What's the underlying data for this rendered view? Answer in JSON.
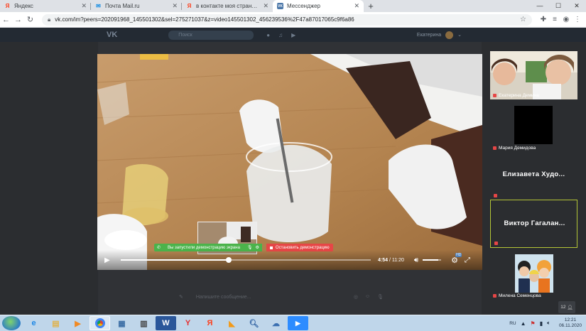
{
  "browser": {
    "tabs": [
      {
        "title": "Яндекс",
        "favicon": "Я",
        "favicon_color": "#fc3f1d",
        "active": false
      },
      {
        "title": "Почта Mail.ru",
        "favicon": "✉",
        "favicon_color": "#168de2",
        "active": false
      },
      {
        "title": "в контакте моя страница вход ...",
        "favicon": "Я",
        "favicon_color": "#fc3f1d",
        "active": false
      },
      {
        "title": "Мессенджер",
        "favicon": "VK",
        "favicon_color": "#4a76a8",
        "active": true
      }
    ],
    "new_tab_label": "+",
    "url": "vk.com/im?peers=202091968_145501302&sel=275271037&z=video145501302_456239536%2F47a87017065c9f6a86"
  },
  "vk": {
    "search_placeholder": "Поиск",
    "user_name": "Екатерина",
    "compose_placeholder": "Напишите сообщение..."
  },
  "video": {
    "current_time": "4:54",
    "total_time": "11:20",
    "progress": 0.433,
    "buffered": 1.0,
    "volume": 0.85,
    "quality_badge": "HD"
  },
  "screen_share": {
    "status_text": "Вы запустили демонстрацию экрана",
    "stop_label": "Остановить демонстрацию",
    "status_color": "#4bb34b",
    "stop_color": "#e64646"
  },
  "participants": [
    {
      "name": "Екатерина Демина",
      "type": "video"
    },
    {
      "name": "Мария Демидова",
      "type": "black"
    },
    {
      "name": "Елизавета Худо...",
      "type": "name"
    },
    {
      "name": "Виктор Гагалан...",
      "type": "name",
      "selected": true
    },
    {
      "name": "Милена Семенцова",
      "type": "avatar"
    }
  ],
  "participants_count": "12",
  "taskbar": {
    "language": "RU",
    "time": "12:21",
    "date": "06.11.2020"
  }
}
